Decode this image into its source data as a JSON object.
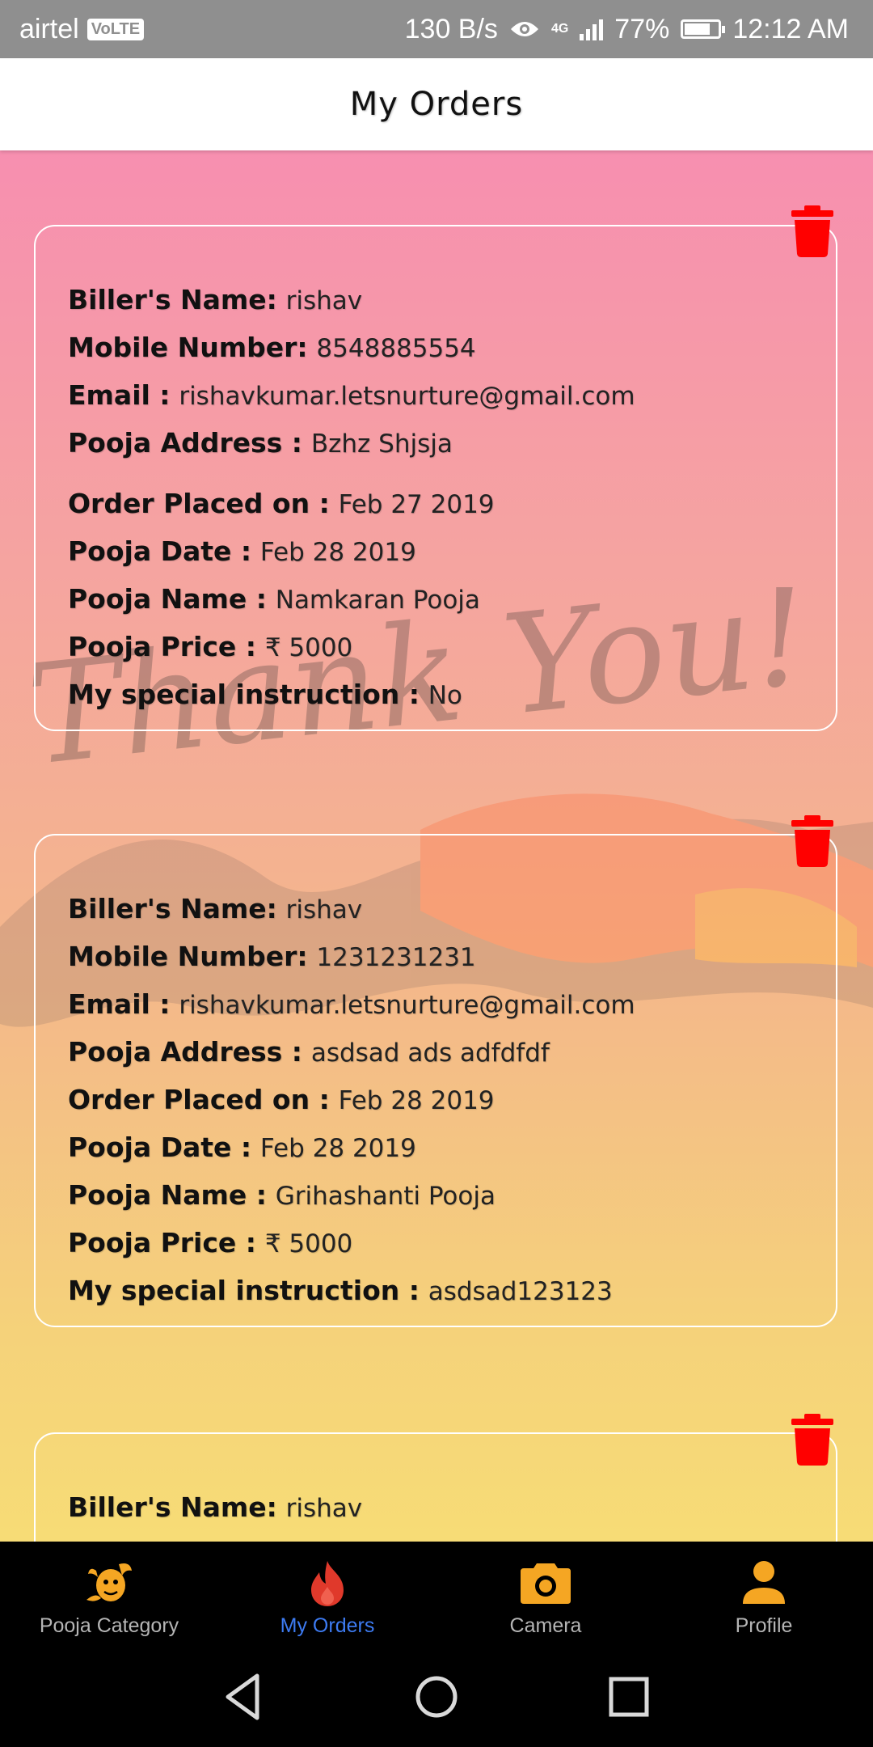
{
  "status_bar": {
    "carrier": "airtel",
    "volte": "VoLTE",
    "net_speed": "130 B/s",
    "network": "4G",
    "battery": "77%",
    "battery_level": 0.77,
    "time": "12:12 AM"
  },
  "app_bar": {
    "title": "My Orders"
  },
  "orders": [
    {
      "billers_name_label": "Biller's Name:",
      "billers_name": "rishav",
      "mobile_label": "Mobile Number:",
      "mobile": "8548885554",
      "email_label": "Email :",
      "email": "rishavkumar.letsnurture@gmail.com",
      "address_label": "Pooja Address :",
      "address": "Bzhz Shjsja",
      "placed_label": "Order Placed on :",
      "placed": "Feb 27 2019",
      "pooja_date_label": "Pooja Date :",
      "pooja_date": "Feb 28 2019",
      "pooja_name_label": "Pooja Name :",
      "pooja_name": "Namkaran Pooja",
      "price_label": "Pooja Price :",
      "price": "₹ 5000",
      "instruction_label": "My special instruction :",
      "instruction": "No"
    },
    {
      "billers_name_label": "Biller's Name:",
      "billers_name": "rishav",
      "mobile_label": "Mobile Number:",
      "mobile": "1231231231",
      "email_label": "Email :",
      "email": "rishavkumar.letsnurture@gmail.com",
      "address_label": "Pooja Address :",
      "address": "asdsad ads adfdfdf",
      "placed_label": "Order Placed on :",
      "placed": "Feb 28 2019",
      "pooja_date_label": "Pooja Date :",
      "pooja_date": "Feb 28 2019",
      "pooja_name_label": "Pooja Name :",
      "pooja_name": "Grihashanti Pooja",
      "price_label": "Pooja Price :",
      "price": "₹ 5000",
      "instruction_label": "My special instruction :",
      "instruction": "asdsad123123"
    },
    {
      "billers_name_label": "Biller's Name:",
      "billers_name": "rishav"
    }
  ],
  "watermark_text": "Thank You!",
  "bottom_nav": [
    {
      "label": "Pooja Category",
      "icon": "pooja-category-icon",
      "active": false
    },
    {
      "label": "My Orders",
      "icon": "fire-icon",
      "active": true
    },
    {
      "label": "Camera",
      "icon": "camera-icon",
      "active": false
    },
    {
      "label": "Profile",
      "icon": "profile-icon",
      "active": false
    }
  ],
  "colors": {
    "trash": "#ff0000",
    "nav_active": "#3d7bf2",
    "icon_orange": "#f5a623",
    "fire_red": "#e0392b"
  }
}
